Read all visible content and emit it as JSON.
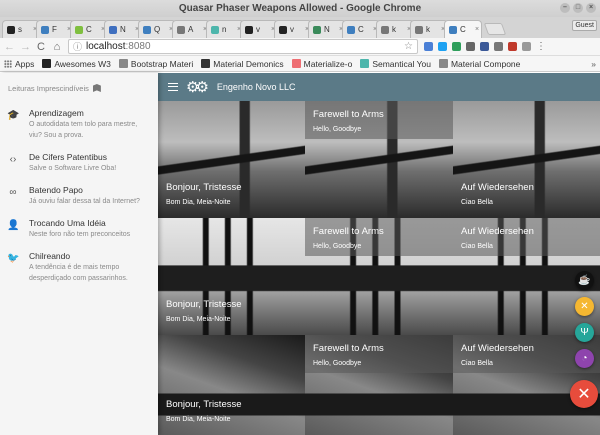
{
  "window": {
    "title": "Quasar Phaser Weapons Allowed - Google Chrome",
    "guest_label": "Guest"
  },
  "tabs": [
    {
      "label": "s",
      "color": "#222222"
    },
    {
      "label": "F",
      "color": "#3f7fbf"
    },
    {
      "label": "C",
      "color": "#7fbf3f"
    },
    {
      "label": "N",
      "color": "#3f6fbf"
    },
    {
      "label": "Q",
      "color": "#3f7fbf"
    },
    {
      "label": "A",
      "color": "#777777"
    },
    {
      "label": "n",
      "color": "#4db6ac"
    },
    {
      "label": "v",
      "color": "#222222"
    },
    {
      "label": "v",
      "color": "#222222"
    },
    {
      "label": "N",
      "color": "#3a8a5a"
    },
    {
      "label": "C",
      "color": "#3f7fbf"
    },
    {
      "label": "k",
      "color": "#777777"
    },
    {
      "label": "k",
      "color": "#777777"
    },
    {
      "label": "C",
      "color": "#3f7fbf"
    }
  ],
  "address": {
    "host": "localhost",
    "port": ":8080"
  },
  "bookmarks": [
    {
      "label": "Apps",
      "icon": "apps-icon",
      "color": "#777777"
    },
    {
      "label": "Awesomes W3",
      "icon": "github-icon",
      "color": "#222222"
    },
    {
      "label": "Bootstrap Materi",
      "icon": "page-icon",
      "color": "#888888"
    },
    {
      "label": "Material Demonics",
      "icon": "image-icon",
      "color": "#333333"
    },
    {
      "label": "Materialize-o",
      "icon": "m-icon",
      "color": "#ee6e73"
    },
    {
      "label": "Semantical You",
      "icon": "s-icon",
      "color": "#4db6ac"
    },
    {
      "label": "Material Compone",
      "icon": "page-icon",
      "color": "#888888"
    }
  ],
  "bookmarks_overflow": "»",
  "drawer": {
    "header": "Leituras Imprescindíveis",
    "items": [
      {
        "icon": "school-icon",
        "glyph": "🎓",
        "title": "Aprendizagem",
        "subtitle": "O autodidata tem tolo para mestre, viu? Sou a prova."
      },
      {
        "icon": "code-icon",
        "glyph": "‹›",
        "title": "De Cifers Patentibus",
        "subtitle": "Salve o Software Livre Oba!"
      },
      {
        "icon": "infinity-icon",
        "glyph": "∞",
        "title": "Batendo Papo",
        "subtitle": "Já ouviu falar dessa tal da Internet?"
      },
      {
        "icon": "record-voice-icon",
        "glyph": "👤",
        "title": "Trocando Uma Idéia",
        "subtitle": "Neste foro não tem preconceitos"
      },
      {
        "icon": "twitter-icon",
        "glyph": "🐦",
        "title": "Chilreando",
        "subtitle": "A tendência é de mais tempo desperdiçado com passarinhos."
      }
    ]
  },
  "toolbar": {
    "title": "Engenho Novo LLC"
  },
  "cards": [
    {
      "title": "Bonjour, Tristesse",
      "subtitle": "Bom Dia, Meia-Noite",
      "image": "bridge",
      "pos": "bottom"
    },
    {
      "title": "Farewell to Arms",
      "subtitle": "Hello, Goodbye",
      "image": "bridge",
      "pos": "top"
    },
    {
      "title": "Auf Wiedersehen",
      "subtitle": "Ciao Bella",
      "image": "bridge",
      "pos": "bottom"
    },
    {
      "title": "",
      "subtitle": "",
      "image": "ship",
      "pos": "none"
    },
    {
      "title": "Farewell to Arms",
      "subtitle": "Hello, Goodbye",
      "image": "ship",
      "pos": "top"
    },
    {
      "title": "Auf Wiedersehen",
      "subtitle": "Ciao Bella",
      "image": "ship",
      "pos": "top"
    },
    {
      "title": "Bonjour, Tristesse",
      "subtitle": "Bom Dia, Meia-Noite",
      "image": "room",
      "pos": "bottom"
    },
    {
      "title": "Farewell to Arms",
      "subtitle": "Hello, Goodbye",
      "image": "room",
      "pos": "top"
    },
    {
      "title": "Auf Wiedersehen",
      "subtitle": "Ciao Bella",
      "image": "room",
      "pos": "top"
    }
  ],
  "ship_card_texts": {
    "title": "Bonjour, Tristesse",
    "subtitle": "Bom Dia, Meia-Noite"
  },
  "fabs": [
    {
      "icon": "coffee-icon",
      "glyph": "☕",
      "color": "#111111"
    },
    {
      "icon": "fork-knife-icon",
      "glyph": "✕",
      "color": "#f5b731"
    },
    {
      "icon": "restaurant-icon",
      "glyph": "Ψ",
      "color": "#26a69a"
    },
    {
      "icon": "pizza-icon",
      "glyph": "◔",
      "color": "#8e44ad"
    }
  ],
  "main_fab": {
    "icon": "close-icon",
    "glyph": "✕",
    "color": "#e74c3c"
  }
}
